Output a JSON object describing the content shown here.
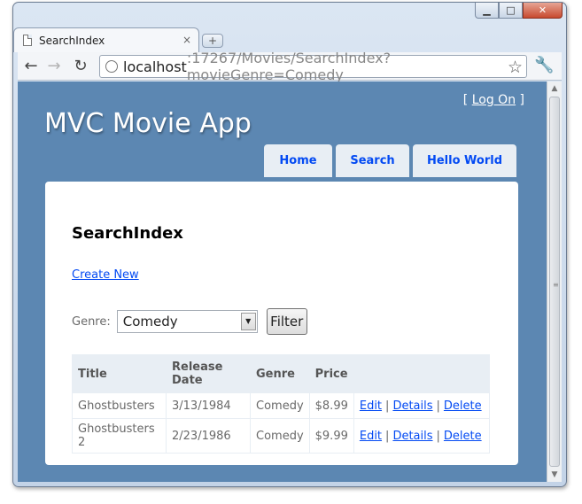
{
  "browser": {
    "tab_title": "SearchIndex",
    "tab_close": "×",
    "new_tab": "+",
    "url_host": "localhost",
    "url_rest": ":17267/Movies/SearchIndex?movieGenre=Comedy",
    "window_buttons": {
      "minimize": "▁",
      "maximize": "□",
      "close": "✕"
    },
    "icons": [
      "back-arrow-icon",
      "forward-arrow-icon",
      "reload-icon",
      "globe-icon",
      "star-icon",
      "wrench-icon",
      "page-icon"
    ]
  },
  "site": {
    "login_open": "[ ",
    "login_link": "Log On",
    "login_close": " ]",
    "title": "MVC Movie App",
    "menu": [
      {
        "label": "Home"
      },
      {
        "label": "Search"
      },
      {
        "label": "Hello World"
      }
    ]
  },
  "page": {
    "heading": "SearchIndex",
    "create_new": "Create New",
    "genre_label": "Genre:",
    "genre_selected": "Comedy",
    "filter_button": "Filter"
  },
  "table": {
    "headers": [
      "Title",
      "Release Date",
      "Genre",
      "Price",
      ""
    ],
    "rows": [
      {
        "title": "Ghostbusters",
        "release_date": "3/13/1984",
        "genre": "Comedy",
        "price": "$8.99"
      },
      {
        "title": "Ghostbusters 2",
        "release_date": "2/23/1986",
        "genre": "Comedy",
        "price": "$9.99"
      }
    ],
    "actions": {
      "edit": "Edit",
      "details": "Details",
      "delete": "Delete",
      "separator": "|"
    }
  },
  "colors": {
    "page_bg": "#5c87b2",
    "link": "#034af3",
    "menu_bg": "#e8eef4"
  }
}
